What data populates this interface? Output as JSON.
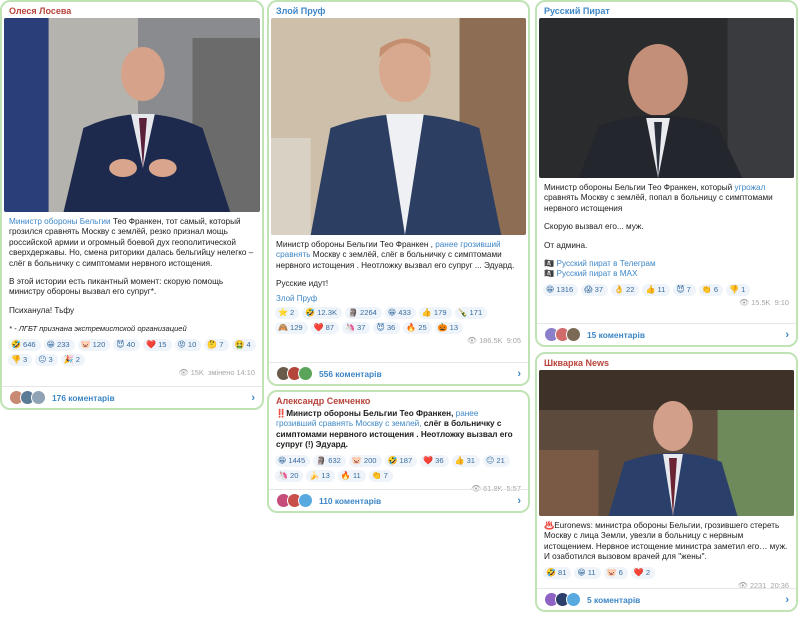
{
  "posts": [
    {
      "author": "Олеся Лосева",
      "author_color": "#b8433a",
      "text_link": "Министр обороны Бельгии",
      "text_1": " Тео Франкен, тот самый, который грозился сравнять Москву с землёй, резко признал мощь российской армии и огромный боевой дух геополитической сверхдержавы. Но, смена риторики далась бельгийцу нелегко – слёг в больничку с симптомами нервного истощения.",
      "text_2": "В этой истории есть пикантный момент: скорую помощь министру обороны вызвал его супруг*.",
      "text_3": "Психанула! Тьфу",
      "note": "* - ЛГБТ признана экстремистской организацией",
      "reactions": [
        {
          "e": "🤣",
          "n": "646"
        },
        {
          "e": "😁",
          "n": "233"
        },
        {
          "e": "🐷",
          "n": "120"
        },
        {
          "e": "😈",
          "n": "40"
        },
        {
          "e": "❤️",
          "n": "15"
        },
        {
          "e": "😡",
          "n": "10"
        },
        {
          "e": "🤔",
          "n": "7"
        },
        {
          "e": "🤮",
          "n": "4"
        },
        {
          "e": "👎",
          "n": "3"
        },
        {
          "e": "😐",
          "n": "3"
        },
        {
          "e": "🎉",
          "n": "2"
        }
      ],
      "views": "15K",
      "time": "змінено 14:10",
      "comments": "176 коментарів"
    },
    {
      "author": "Злой Пруф",
      "author_color": "#3d86c6",
      "text_1": "Министр обороны Бельгии Тео Франкен , ",
      "text_link": "ранее грозивший сравнять",
      "text_2": " Москву с землёй, слёг в больничку с симптомами нервного истощения . Неотложку вызвал его супруг ... Эдуард.",
      "text_3": "Русские идут!",
      "signature": "Злой Пруф",
      "reactions": [
        {
          "e": "⭐",
          "n": "2"
        },
        {
          "e": "🤣",
          "n": "12.3K"
        },
        {
          "e": "🗿",
          "n": "2264"
        },
        {
          "e": "😁",
          "n": "433"
        },
        {
          "e": "👍",
          "n": "179"
        },
        {
          "e": "🍾",
          "n": "171"
        },
        {
          "e": "🙈",
          "n": "129"
        },
        {
          "e": "❤️",
          "n": "87"
        },
        {
          "e": "🦄",
          "n": "37"
        },
        {
          "e": "😈",
          "n": "36"
        },
        {
          "e": "🔥",
          "n": "25"
        },
        {
          "e": "🎃",
          "n": "13"
        }
      ],
      "views": "186.5K",
      "time": "9:05",
      "comments": "556 коментарів"
    },
    {
      "author": "Русский Пират",
      "author_color": "#3d86c6",
      "text_1": "Министр обороны Бельгии Тео Франкен, который ",
      "text_link": "угрожал",
      "text_2": " сравнять Москву с землёй, попал в больницу с симптомами нервного истощения",
      "text_3": "Скорую вызвал его... муж.",
      "text_4": "От админа.",
      "link_1": "Русский пират в Телеграм",
      "link_2": "Русский пират в MAX",
      "reactions": [
        {
          "e": "😁",
          "n": "1316"
        },
        {
          "e": "😱",
          "n": "37"
        },
        {
          "e": "👌",
          "n": "22"
        },
        {
          "e": "👍",
          "n": "11"
        },
        {
          "e": "😈",
          "n": "7"
        },
        {
          "e": "👏",
          "n": "6"
        },
        {
          "e": "👎",
          "n": "1"
        }
      ],
      "views": "15.5K",
      "time": "9:10",
      "comments": "15 коментарів"
    },
    {
      "author": "Александр Семченко",
      "author_color": "#b8433a",
      "prefix": "‼️",
      "text_1": "Министр обороны Бельгии Тео Франкен, ",
      "text_link": "ранее грозивший сравнять Москву с землей,",
      "text_2": " слёг в больничку с симптомами нервного истощения . Неотложку вызвал его супруг (!) Эдуард.",
      "reactions": [
        {
          "e": "😁",
          "n": "1445"
        },
        {
          "e": "🗿",
          "n": "632"
        },
        {
          "e": "🐷",
          "n": "200"
        },
        {
          "e": "🤣",
          "n": "187"
        },
        {
          "e": "❤️",
          "n": "36"
        },
        {
          "e": "👍",
          "n": "31"
        },
        {
          "e": "😐",
          "n": "21"
        },
        {
          "e": "🦄",
          "n": "20"
        },
        {
          "e": "🍌",
          "n": "13"
        },
        {
          "e": "🔥",
          "n": "11"
        },
        {
          "e": "👏",
          "n": "7"
        }
      ],
      "views": "61.8K",
      "time": "5:57",
      "comments": "110 коментарів"
    },
    {
      "author": "Шкварка News",
      "author_color": "#b8433a",
      "prefix": "♨️",
      "text_1": "Euronews: министра обороны Бельгии, грозившего стереть Москву с лица Земли, увезли в больницу с нервным истощением. Нервное истощение министра заметил его… муж. И озаботился вызовом врачей для \"жены\".",
      "reactions": [
        {
          "e": "🤣",
          "n": "81"
        },
        {
          "e": "😁",
          "n": "11"
        },
        {
          "e": "🐷",
          "n": "6"
        },
        {
          "e": "❤️",
          "n": "2"
        }
      ],
      "views": "2231",
      "time": "20:36",
      "comments": "5 коментарів"
    }
  ]
}
